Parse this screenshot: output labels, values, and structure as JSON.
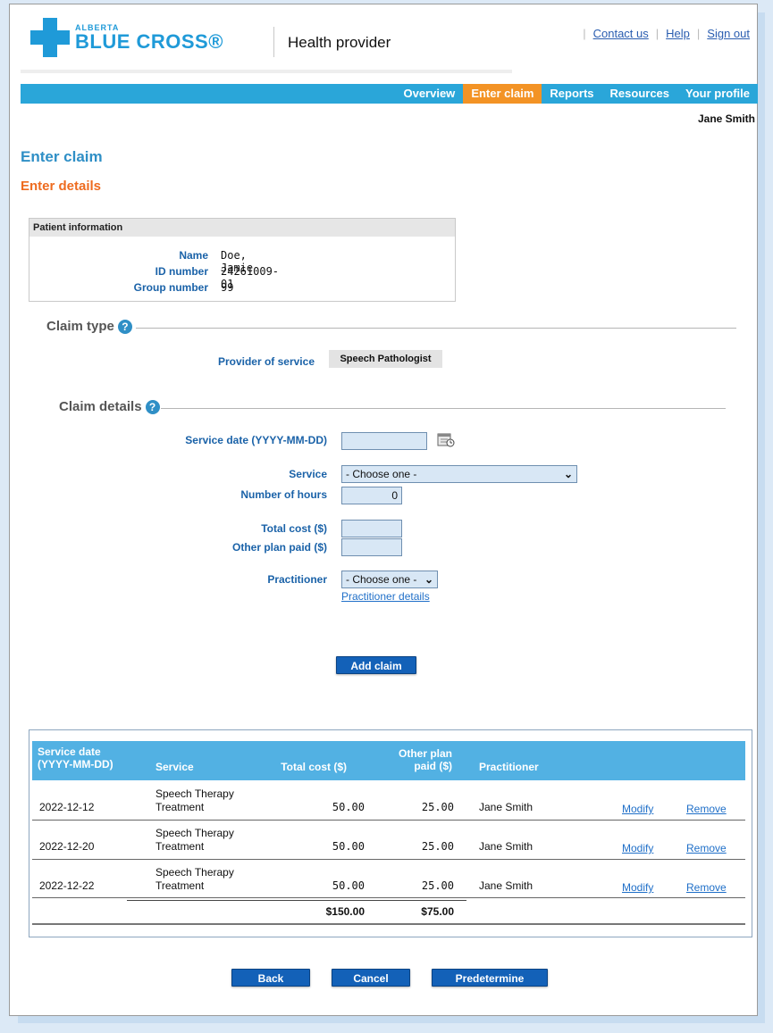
{
  "header": {
    "brand_small": "ALBERTA",
    "brand_big": "BLUE CROSS®",
    "provider": "Health provider",
    "links": [
      "Contact us",
      "Help",
      "Sign out"
    ]
  },
  "nav": {
    "items": [
      "Overview",
      "Enter claim",
      "Reports",
      "Resources",
      "Your profile"
    ],
    "active": "Enter claim",
    "user": "Jane Smith"
  },
  "page": {
    "title": "Enter claim",
    "subtitle": "Enter details"
  },
  "patient": {
    "header": "Patient information",
    "name_label": "Name",
    "name": "Doe, Jamie",
    "id_label": "ID number",
    "id": "24261009-01",
    "group_label": "Group number",
    "group": "99"
  },
  "claim_type": {
    "title": "Claim type",
    "provider_label": "Provider of service",
    "provider_value": "Speech Pathologist"
  },
  "claim_details": {
    "title": "Claim details",
    "service_date_label": "Service date (YYYY-MM-DD)",
    "service_date": "",
    "service_label": "Service",
    "service_value": "- Choose one -",
    "hours_label": "Number of hours",
    "hours_value": "0",
    "total_cost_label": "Total cost ($)",
    "other_plan_label": "Other plan paid ($)",
    "practitioner_label": "Practitioner",
    "practitioner_value": "- Choose one -",
    "practitioner_details_link": "Practitioner details",
    "add_claim": "Add claim"
  },
  "table": {
    "headers": {
      "service_date": "Service date (YYYY-MM-DD)",
      "service": "Service",
      "total_cost": "Total cost ($)",
      "other_plan": "Other plan paid ($)",
      "practitioner": "Practitioner"
    },
    "rows": [
      {
        "date": "2022-12-12",
        "service": "Speech Therapy Treatment",
        "total": "50.00",
        "other": "25.00",
        "practitioner": "Jane Smith",
        "modify": "Modify",
        "remove": "Remove"
      },
      {
        "date": "2022-12-20",
        "service": "Speech Therapy Treatment",
        "total": "50.00",
        "other": "25.00",
        "practitioner": "Jane Smith",
        "modify": "Modify",
        "remove": "Remove"
      },
      {
        "date": "2022-12-22",
        "service": "Speech Therapy Treatment",
        "total": "50.00",
        "other": "25.00",
        "practitioner": "Jane Smith",
        "modify": "Modify",
        "remove": "Remove"
      }
    ],
    "totals": {
      "total": "$150.00",
      "other": "$75.00"
    }
  },
  "buttons": {
    "back": "Back",
    "cancel": "Cancel",
    "predetermine": "Predetermine"
  },
  "colors": {
    "brand_blue": "#1f9ad8",
    "nav_bar": "#2aa6d9",
    "nav_active": "#f39325",
    "title_orange": "#ee6b1f",
    "button": "#1361b8"
  }
}
